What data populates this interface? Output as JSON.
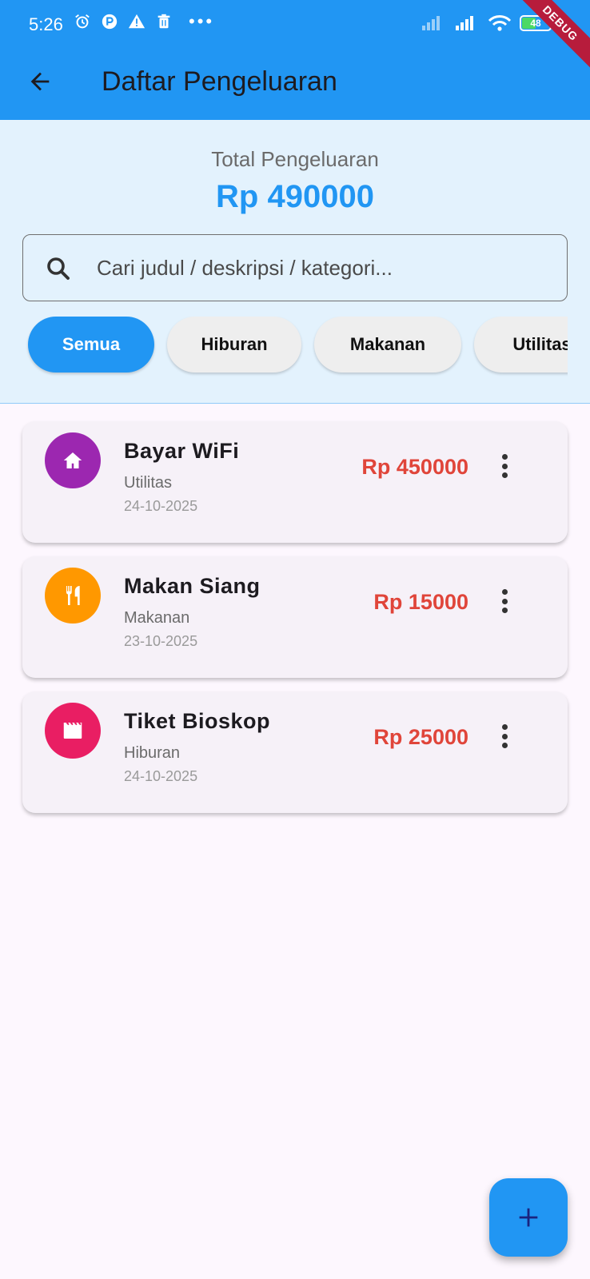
{
  "status_bar": {
    "time": "5:26",
    "battery": "48",
    "debug_banner": "DEBUG"
  },
  "appbar": {
    "title": "Daftar Pengeluaran",
    "back_icon": "arrow-back-icon"
  },
  "summary": {
    "label": "Total Pengeluaran",
    "value": "Rp 490000"
  },
  "search": {
    "placeholder": "Cari judul / deskripsi / kategori...",
    "value": ""
  },
  "filters": [
    {
      "label": "Semua",
      "active": true
    },
    {
      "label": "Hiburan",
      "active": false
    },
    {
      "label": "Makanan",
      "active": false
    },
    {
      "label": "Utilitas",
      "active": false
    }
  ],
  "expenses": [
    {
      "title": "Bayar WiFi",
      "category": "Utilitas",
      "date": "24-10-2025",
      "amount": "Rp 450000",
      "icon": "home-icon",
      "color": "#9c27b0"
    },
    {
      "title": "Makan Siang",
      "category": "Makanan",
      "date": "23-10-2025",
      "amount": "Rp 15000",
      "icon": "restaurant-icon",
      "color": "#ff9800"
    },
    {
      "title": "Tiket Bioskop",
      "category": "Hiburan",
      "date": "24-10-2025",
      "amount": "Rp 25000",
      "icon": "movie-icon",
      "color": "#e91e63"
    }
  ],
  "fab": {
    "icon": "add-icon"
  },
  "colors": {
    "primary": "#2196f3",
    "summary_bg": "#e3f2fd",
    "amount": "#e0453a"
  }
}
